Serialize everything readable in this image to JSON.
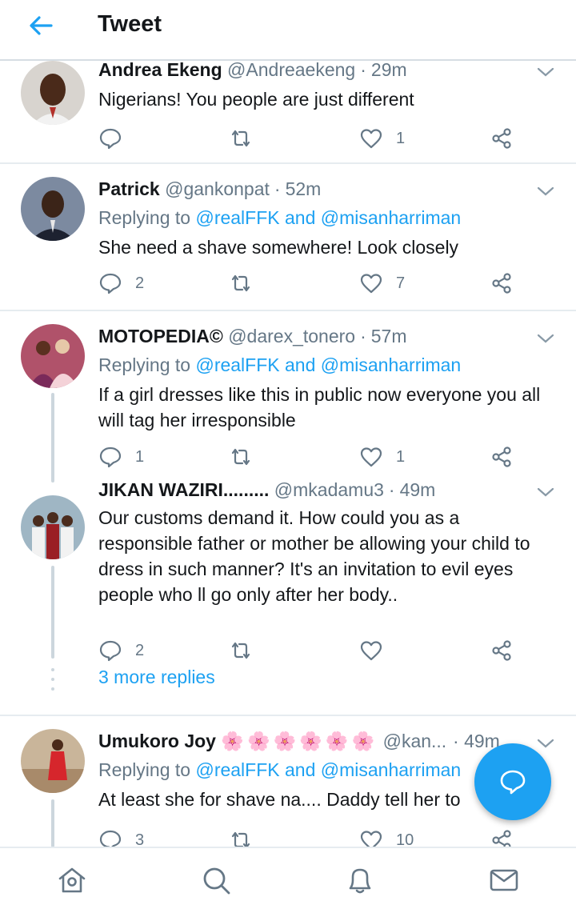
{
  "header": {
    "title": "Tweet"
  },
  "tweets": [
    {
      "name": "Andrea Ekeng",
      "handle": "@Andreaekeng",
      "time": "29m",
      "reply_prefix": "",
      "reply_mention": "",
      "text": "Nigerians! You people are just different",
      "replies": "",
      "retweets": "",
      "likes": "1"
    },
    {
      "name": "Patrick",
      "handle": "@gankonpat",
      "time": "52m",
      "reply_prefix": "Replying to ",
      "reply_mention": "@realFFK and @misanharriman",
      "text": "She need a shave somewhere! Look closely",
      "replies": "2",
      "retweets": "",
      "likes": "7"
    },
    {
      "name": "MOTOPEDIA©",
      "handle": "@darex_tonero",
      "time": "57m",
      "reply_prefix": "Replying to ",
      "reply_mention": "@realFFK and @misanharriman",
      "text": "If a girl dresses like this in public now everyone you all will tag her irresponsible",
      "replies": "1",
      "retweets": "",
      "likes": "1"
    },
    {
      "name": "JIKAN WAZIRI.........",
      "handle": "@mkadamu3",
      "time": "49m",
      "reply_prefix": "",
      "reply_mention": "",
      "text": "Our customs demand it. How could you as a responsible father or mother be allowing your child to dress in such manner? It's an invitation to evil eyes people who ll go only after her body..",
      "replies": "2",
      "retweets": "",
      "likes": ""
    },
    {
      "name": "Umukoro Joy",
      "name_emoji": "🌸🌸🌸🌸🌸🌸",
      "handle": "@kan...",
      "time": "49m",
      "reply_prefix": "Replying to ",
      "reply_mention": "@realFFK and @misanharriman",
      "text": "At least she for shave na.... Daddy tell her to",
      "replies": "3",
      "retweets": "",
      "likes": "10"
    }
  ],
  "more_replies": "3 more replies",
  "colors": {
    "accent": "#1da1f2",
    "secondary_text": "#657786",
    "divider": "#e6ecf0"
  },
  "icons": {
    "header": "back-arrow-icon",
    "actions": [
      "reply-icon",
      "retweet-icon",
      "like-icon",
      "share-icon"
    ],
    "fab": "compose-reply-icon",
    "nav": [
      "home-icon",
      "search-icon",
      "notifications-icon",
      "messages-icon"
    ]
  }
}
